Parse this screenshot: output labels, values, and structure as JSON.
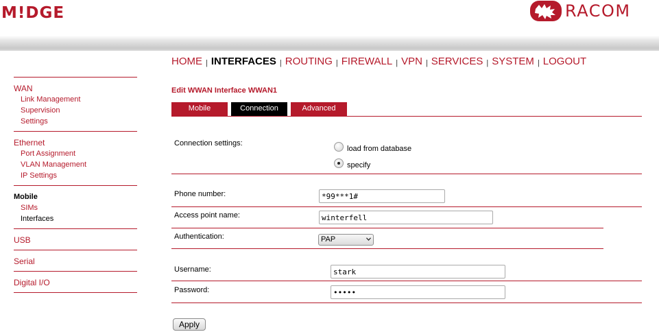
{
  "brand": {
    "product": "M!DGE",
    "vendor": "RACOM",
    "brand_color": "#b51a2b"
  },
  "topnav": [
    {
      "label": "HOME",
      "active": false
    },
    {
      "label": "INTERFACES",
      "active": true
    },
    {
      "label": "ROUTING",
      "active": false
    },
    {
      "label": "FIREWALL",
      "active": false
    },
    {
      "label": "VPN",
      "active": false
    },
    {
      "label": "SERVICES",
      "active": false
    },
    {
      "label": "SYSTEM",
      "active": false
    },
    {
      "label": "LOGOUT",
      "active": false
    }
  ],
  "nav_separator": "|",
  "sidebar": {
    "wan": {
      "label": "WAN",
      "items": [
        "Link Management",
        "Supervision",
        "Settings"
      ]
    },
    "ethernet": {
      "label": "Ethernet",
      "items": [
        "Port Assignment",
        "VLAN Management",
        "IP Settings"
      ]
    },
    "mobile": {
      "label": "Mobile",
      "items": [
        "SIMs",
        "Interfaces"
      ],
      "active_item": "Interfaces"
    },
    "usb": {
      "label": "USB"
    },
    "serial": {
      "label": "Serial"
    },
    "digital_io": {
      "label": "Digital I/O"
    }
  },
  "main": {
    "title": "Edit WWAN Interface WWAN1",
    "tabs": [
      {
        "label": "Mobile",
        "active": false
      },
      {
        "label": "Connection",
        "active": true
      },
      {
        "label": "Advanced",
        "active": false
      }
    ],
    "connection_settings": {
      "label": "Connection settings:",
      "options": [
        {
          "label": "load from database",
          "checked": false
        },
        {
          "label": "specify",
          "checked": true
        }
      ]
    },
    "phone_number": {
      "label": "Phone number:",
      "value": "*99***1#"
    },
    "apn": {
      "label": "Access point name:",
      "value": "winterfell"
    },
    "authentication": {
      "label": "Authentication:",
      "value": "PAP"
    },
    "username": {
      "label": "Username:",
      "value": "stark"
    },
    "password": {
      "label": "Password:",
      "value": "•••••"
    },
    "apply_label": "Apply"
  }
}
